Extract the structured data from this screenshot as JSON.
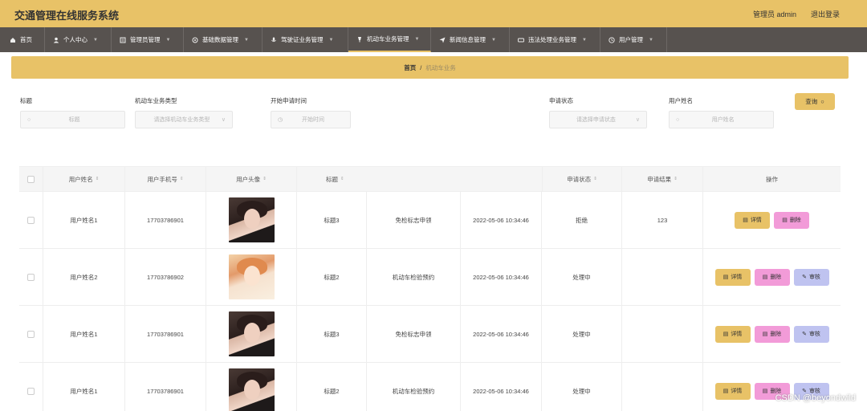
{
  "app": {
    "title": "交通管理在线服务系统"
  },
  "header": {
    "user_label": "管理员 admin",
    "logout_label": "退出登录"
  },
  "nav": [
    {
      "label": "首页",
      "icon": "home-icon"
    },
    {
      "label": "个人中心",
      "icon": "user-icon"
    },
    {
      "label": "管理员管理",
      "icon": "admin-icon"
    },
    {
      "label": "基础数据管理",
      "icon": "gear-icon"
    },
    {
      "label": "驾驶证业务管理",
      "icon": "mic-icon"
    },
    {
      "label": "机动车业务管理",
      "icon": "car-icon"
    },
    {
      "label": "新闻信息管理",
      "icon": "send-icon"
    },
    {
      "label": "违法处理业务管理",
      "icon": "ticket-icon"
    },
    {
      "label": "用户管理",
      "icon": "clock-icon"
    }
  ],
  "breadcrumb": {
    "home": "首页",
    "separator": "/",
    "current": "机动车业务"
  },
  "search": {
    "title_label": "标题",
    "title_placeholder": "标题",
    "type_label": "机动车业务类型",
    "type_placeholder": "请选择机动车业务类型",
    "start_label": "开始申请时间",
    "start_placeholder": "开始时间",
    "status_label": "申请状态",
    "status_placeholder": "请选择申请状态",
    "username_label": "用户姓名",
    "username_placeholder": "用户姓名",
    "query_label": "查询"
  },
  "table": {
    "headers": {
      "username": "用户姓名",
      "phone": "用户手机号",
      "avatar": "用户头像",
      "title": "标题",
      "status": "申请状态",
      "result": "申请结果",
      "ops": "操作"
    },
    "rows": [
      {
        "username": "用户姓名1",
        "phone": "17703786901",
        "title": "标题3",
        "type": "免检标志申领",
        "time": "2022-05-06 10:34:46",
        "status": "拒绝",
        "result": "123",
        "avatar": "dark"
      },
      {
        "username": "用户姓名2",
        "phone": "17703786902",
        "title": "标题2",
        "type": "机动车检验预约",
        "time": "2022-05-06 10:34:46",
        "status": "处理中",
        "result": "",
        "avatar": "light"
      },
      {
        "username": "用户姓名1",
        "phone": "17703786901",
        "title": "标题3",
        "type": "免检标志申领",
        "time": "2022-05-06 10:34:46",
        "status": "处理中",
        "result": "",
        "avatar": "dark"
      },
      {
        "username": "用户姓名1",
        "phone": "17703786901",
        "title": "标题2",
        "type": "机动车检验预约",
        "time": "2022-05-06 10:34:46",
        "status": "处理中",
        "result": "",
        "avatar": "dark"
      }
    ],
    "actions": {
      "detail": "详情",
      "delete": "删除",
      "review": "审核"
    }
  },
  "watermark": "CSDN @beyondwild",
  "colors": {
    "accent": "#e8c267",
    "nav_bg": "#57524f",
    "delete": "#f29bd8",
    "review": "#bfc3f0"
  }
}
